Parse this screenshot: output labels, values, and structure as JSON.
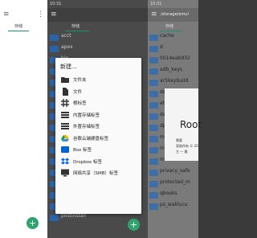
{
  "screen1": {
    "tabs": [
      "存储"
    ],
    "fab": "+"
  },
  "screen2": {
    "status_time": "10:31",
    "tabs": [
      "存储"
    ],
    "files": [
      "acct",
      "apex",
      "bin",
      "cache",
      "config",
      "d",
      "data",
      "debug_ramdisk",
      "dev",
      "etc",
      "init",
      "linkerconfig",
      "metadata",
      "mnt",
      "odm",
      "oem",
      "postinstall",
      "proc",
      "product",
      "sdcard",
      "storage",
      "system",
      "vendor"
    ],
    "fab": "+"
  },
  "dialog": {
    "title": "新建...",
    "items": [
      {
        "label": "文件夹",
        "icon": "folder-icon"
      },
      {
        "label": "文件",
        "icon": "file-icon"
      },
      {
        "label": "根标签",
        "icon": "hash-icon"
      },
      {
        "label": "内置存储标签",
        "icon": "storage-icon"
      },
      {
        "label": "外置存储标签",
        "icon": "external-storage-icon"
      },
      {
        "label": "谷歌云端硬盘标签",
        "icon": "google-drive-icon"
      },
      {
        "label": "Box 标签",
        "icon": "box-icon"
      },
      {
        "label": "Dropbox 标签",
        "icon": "dropbox-icon"
      },
      {
        "label": "网络共享（SMB）标签",
        "icon": "network-icon"
      }
    ]
  },
  "screen3": {
    "status_time": "10:31",
    "title": "/storage/emul",
    "tabs": [
      "存储"
    ],
    "files": [
      {
        "name": "cache",
        "sub": ""
      },
      {
        "name": "d",
        "sub": ""
      },
      {
        "name": "0014eab932",
        "sub": ""
      },
      {
        "name": "adb_keys",
        "sub": ""
      },
      {
        "name": "ar5keybuild",
        "sub": ""
      },
      {
        "name": "dev",
        "sub": ""
      },
      {
        "name": "etc",
        "sub": ""
      },
      {
        "name": "data",
        "sub": ""
      },
      {
        "name": "dpolicy",
        "sub": ""
      },
      {
        "name": "mkv",
        "sub": ""
      },
      {
        "name": "mkv_device_2",
        "sub": ""
      },
      {
        "name": "mnt",
        "sub": ""
      },
      {
        "name": "privacy_safe",
        "sub": ""
      },
      {
        "name": "protected_m",
        "sub": ""
      },
      {
        "name": "qbooks",
        "sub": ""
      },
      {
        "name": "ps_waklucu",
        "sub": ""
      }
    ],
    "root_dialog": {
      "title": "Root",
      "line1": "需要",
      "line2": "获取所有 © 20",
      "line3": "主 — 最"
    }
  },
  "colors": {
    "accent": "#1e8c7a",
    "fab": "#2ea36e",
    "folder": "#2b63a8"
  }
}
